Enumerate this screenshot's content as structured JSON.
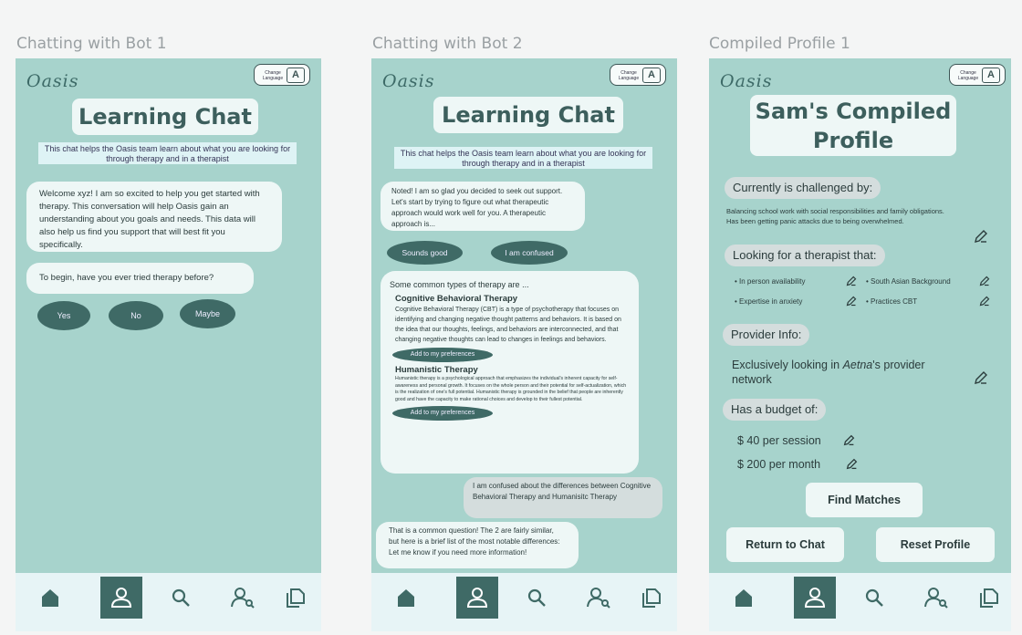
{
  "frames": [
    {
      "title": "Chatting with Bot 1"
    },
    {
      "title": "Chatting with Bot 2"
    },
    {
      "title": "Compiled Profile 1"
    }
  ],
  "common": {
    "logo": "Oasis",
    "lang_line1": "Change",
    "lang_line2": "Language",
    "lang_glyph": "A"
  },
  "chat1": {
    "title": "Learning Chat",
    "info": "This chat helps the Oasis team learn about what you are looking for through therapy and in a therapist",
    "welcome": "Welcome xyz! I am so excited to help you get started with therapy. This conversation will help Oasis gain an understanding about you goals and needs. This data will also help us find you support that will best fit you specifically.",
    "question": "To begin, have you ever tried therapy before?",
    "options": [
      "Yes",
      "No",
      "Maybe"
    ]
  },
  "chat2": {
    "title": "Learning Chat",
    "info": "This chat helps the Oasis team learn about what you are looking for through therapy and in a therapist",
    "bot1": "Noted! I am so glad you decided to seek out support. Let's start by trying to figure out what therapeutic approach would work well for you. A therapeutic approach is...",
    "options": [
      "Sounds good",
      "I am confused"
    ],
    "types_intro": "Some common types of therapy are ...",
    "cbt_title": "Cognitive Behavioral Therapy",
    "cbt_text": "Cognitive Behavioral Therapy (CBT) is a type of psychotherapy that focuses on identifying and changing negative thought patterns and behaviors. It is based on the idea that our thoughts, feelings, and behaviors are interconnected, and that changing negative thoughts can lead to changes in feelings and behaviors.",
    "add_pref": "Add to my preferences",
    "hum_title": "Humanistic Therapy",
    "hum_text": "Humanistic therapy is a psychological approach that emphasizes the individual's inherent capacity for self-awareness and personal growth. It focuses on the whole person and their potential for self-actualization, which is the realization of one's full potential. Humanistic therapy is grounded in the belief that people are inherently good and have the capacity to make rational choices and develop to their fullest potential.",
    "user_msg": "I am confused about the differences between Cognitive Behavioral Therapy and Humanisitc Therapy",
    "bot_reply": "That is a common question! The 2 are fairly similar, but here is a brief list of the most notable differences: Let me know if you need more information!"
  },
  "profile": {
    "title": "Sam's Compiled Profile",
    "challenged_head": "Currently is challenged by:",
    "challenged_text": "Balancing school work with social responsibilities and family obligations. Has been getting panic attacks due to being overwhelmed.",
    "looking_head": "Looking for a therapist that:",
    "prefs": [
      "In person availability",
      "South Asian Background",
      "Expertise in anxiety",
      "Practices CBT"
    ],
    "provider_head": "Provider Info:",
    "provider_pre": "Exclusively looking in ",
    "provider_em": "Aetna",
    "provider_post": "'s provider network",
    "budget_head": "Has a budget of:",
    "budget_session": "$ 40 per session",
    "budget_month": "$ 200 per month",
    "find_matches": "Find Matches",
    "return_chat": "Return to Chat",
    "reset": "Reset Profile"
  },
  "colors": {
    "phone_bg": "#a7d3cc",
    "accent": "#3f6a66",
    "card": "#eef7f6",
    "nav_bg": "#e7f4f6"
  },
  "nav_icons": [
    "home-icon",
    "person-icon",
    "search-icon",
    "find-therapist-icon",
    "documents-icon"
  ]
}
